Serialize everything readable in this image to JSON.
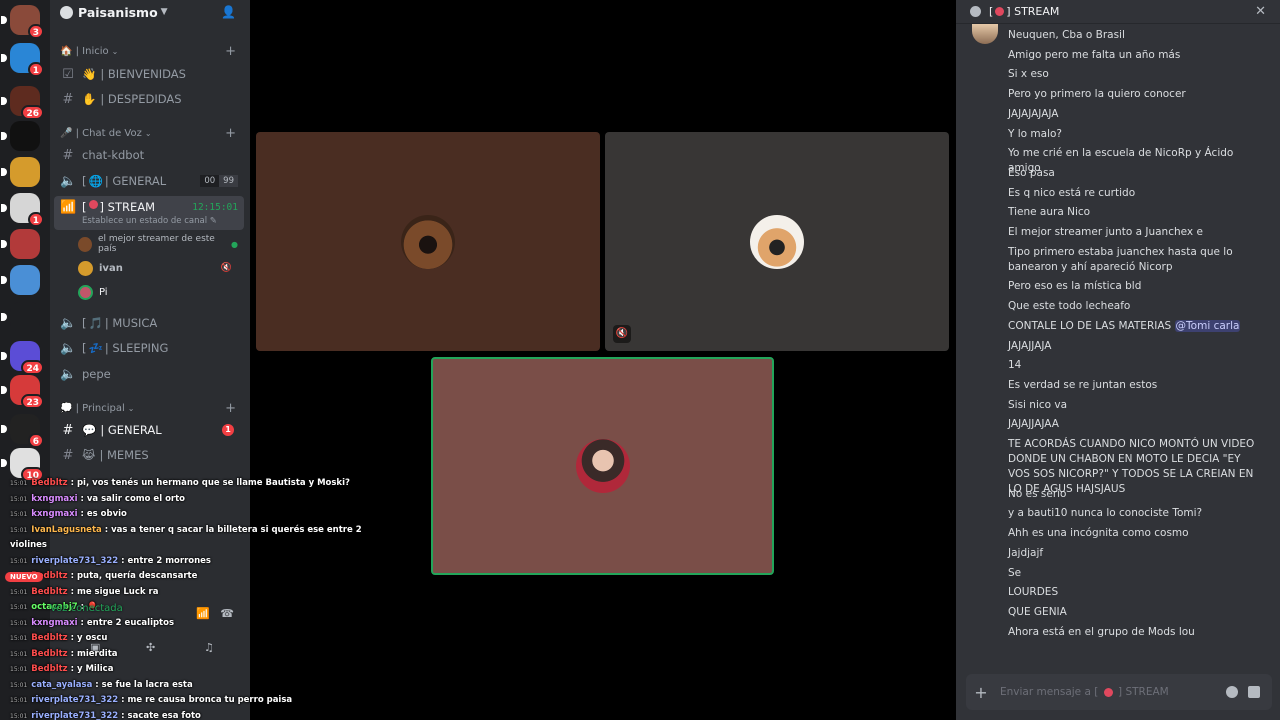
{
  "rail": {
    "servers": [
      {
        "badge": "3",
        "color": "#8a4a3a"
      },
      {
        "badge": "1",
        "color": "#2a86d6"
      },
      {
        "badge": "26",
        "color": "#5e2b1f"
      },
      {
        "badge": "",
        "color": "#111111"
      },
      {
        "badge": "",
        "color": "#d59b2c"
      },
      {
        "badge": "1",
        "color": "#d6d6d6"
      },
      {
        "badge": "",
        "color": "#b23a3a"
      },
      {
        "badge": "",
        "color": "#4a8fd6"
      },
      {
        "badge": "",
        "color": "#1e1f22"
      },
      {
        "badge": "24",
        "color": "#5b4dd6"
      },
      {
        "badge": "23",
        "color": "#d63a3a"
      },
      {
        "badge": "6",
        "color": "#222222"
      },
      {
        "badge": "10",
        "color": "#e0e0e0"
      }
    ]
  },
  "sidebar": {
    "server_name": "Paisanismo",
    "categories": {
      "inicio": "🏠 | Inicio",
      "voz": "🎤 | Chat de Voz",
      "principal": "💭 | Principal"
    },
    "channels": {
      "bienvenidas": "| BIENVENIDAS",
      "despedidas": "| DESPEDIDAS",
      "chat_kdbot": "chat-kdbot",
      "general_voice": "| GENERAL",
      "general_voice_prefix": "[",
      "general_count_a": "00",
      "general_count_b": "99",
      "stream": "] STREAM",
      "stream_prefix": "[",
      "stream_timer": "12:15:01",
      "stream_status": "Establece un estado de canal",
      "musica": "| MUSICA",
      "musica_prefix": "[",
      "sleeping": "| SLEEPING",
      "sleeping_prefix": "[",
      "pepe": "pepe",
      "general_text": "| GENERAL",
      "general_text_mention": "1",
      "memes": "| MEMES"
    },
    "voice_users": [
      {
        "name": "el mejor streamer de este país",
        "color": "#7a4a2a"
      },
      {
        "name": "ivan",
        "color": "#d59b2c"
      },
      {
        "name": "Pi",
        "color": "#c0566a"
      }
    ],
    "voice_connected": "Voz conectada",
    "nuevo": "NUEVO"
  },
  "overlay": {
    "lines": [
      {
        "time": "15:01",
        "user": "Bedbltz",
        "color": "#ff4d4d",
        "msg": "pi, vos tenés un hermano que se llame Bautista y Moski?"
      },
      {
        "time": "15:01",
        "user": "kxngmaxi",
        "color": "#d98cff",
        "msg": "va salir como el orto"
      },
      {
        "time": "15:01",
        "user": "kxngmaxi",
        "color": "#d98cff",
        "msg": "es obvio"
      },
      {
        "time": "15:01",
        "user": "IvanLagusneta",
        "color": "#ffb84d",
        "msg": "vas a tener q sacar la billetera si querés ese entre 2"
      },
      {
        "time": "",
        "user": "",
        "color": "#ffffff",
        "msg": "violines"
      },
      {
        "time": "15:01",
        "user": "riverplate731_322",
        "color": "#9ab0ff",
        "msg": "entre 2 morrones"
      },
      {
        "time": "15:01",
        "user": "Bedbltz",
        "color": "#ff4d4d",
        "msg": "puta, quería descansarte"
      },
      {
        "time": "15:01",
        "user": "Bedbltz",
        "color": "#ff4d4d",
        "msg": "me sigue Luck ra"
      },
      {
        "time": "15:01",
        "user": "octacabj7",
        "color": "#66ff66",
        "msg": "🎈"
      },
      {
        "time": "15:01",
        "user": "kxngmaxi",
        "color": "#d98cff",
        "msg": "entre 2 eucaliptos"
      },
      {
        "time": "15:01",
        "user": "Bedbltz",
        "color": "#ff4d4d",
        "msg": "y oscu"
      },
      {
        "time": "15:01",
        "user": "Bedbltz",
        "color": "#ff4d4d",
        "msg": "mierdita"
      },
      {
        "time": "15:01",
        "user": "Bedbltz",
        "color": "#ff4d4d",
        "msg": "y Milica"
      },
      {
        "time": "15:01",
        "user": "cata_ayalasa",
        "color": "#9ab0ff",
        "msg": "se fue la lacra esta"
      },
      {
        "time": "15:01",
        "user": "riverplate731_322",
        "color": "#9ab0ff",
        "msg": "me re causa bronca tu perro paisa"
      },
      {
        "time": "15:01",
        "user": "riverplate731_322",
        "color": "#9ab0ff",
        "msg": "sacate esa foto"
      }
    ]
  },
  "stage": {
    "tiles": [
      {
        "name": "dog-user",
        "bg": "#4a2d22"
      },
      {
        "name": "selfie-user",
        "bg": "#383635"
      },
      {
        "name": "pi-user",
        "bg": "#7a4e48"
      }
    ]
  },
  "chat": {
    "title": "] STREAM",
    "title_prefix": "[",
    "messages": [
      "Neuquen, Cba o Brasil",
      "Amigo pero me falta un año más",
      "Si x eso",
      "Pero yo primero la quiero conocer",
      "JAJAJAJAJA",
      "Y lo malo?",
      "Yo me crié en la escuela de NicoRp y Ácido amigo",
      "Eso pasa",
      "Es q nico está re curtido",
      "Tiene aura Nico",
      "El mejor streamer junto a Juanchex e",
      "Tipo primero estaba juanchex hasta que lo banearon y ahí apareció Nicorp",
      "Pero eso es la mística bld",
      "Que este todo lecheafo",
      "CONTALE LO DE LAS MATERIAS",
      "JAJAJJAJA",
      "14",
      "Es verdad se re juntan estos",
      "Sisi nico va",
      "JAJAJJAJAA",
      "TE ACORDÁS CUANDO NICO MONTÓ UN VIDEO DONDE UN CHABON EN MOTO LE DECIA \"EY VOS SOS NICORP?\" Y TODOS SE LA CREIAN EN LO DE AGUS HAJSJAUS",
      "No es serio",
      "y a bauti10 nunca lo conociste Tomi?",
      "Ahh es una incógnita como cosmo",
      "Jajdjajf",
      "Se",
      "LOURDES",
      "QUE GENIA",
      "Ahora está en el grupo de Mods lou"
    ],
    "mention": "@Tomi carla",
    "composer_placeholder": "Enviar mensaje a [",
    "composer_suffix": "] STREAM"
  }
}
